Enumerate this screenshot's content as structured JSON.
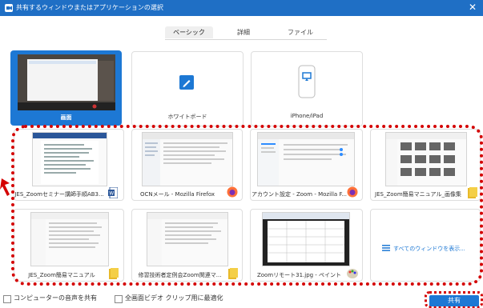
{
  "titlebar": {
    "title": "共有するウィンドウまたはアプリケーションの選択",
    "close_label": "✕"
  },
  "tabs": [
    {
      "label": "ベーシック",
      "active": true
    },
    {
      "label": "詳細",
      "active": false
    },
    {
      "label": "ファイル",
      "active": false
    }
  ],
  "top_tiles": {
    "screen": {
      "label": "画面"
    },
    "whiteboard": {
      "label": "ホワイトボード"
    },
    "iphone": {
      "label": "iPhone/iPad"
    }
  },
  "windows": [
    {
      "label": "JES_Zoomセミナー講師手順AB3...",
      "icon": "word-icon"
    },
    {
      "label": "OCNメール - Mozilla Firefox",
      "icon": "firefox-icon"
    },
    {
      "label": "アカウント設定 - Zoom - Mozilla F...",
      "icon": "firefox-icon"
    },
    {
      "label": "JES_Zoom簡易マニュアル_画像集",
      "icon": "folder-icon"
    },
    {
      "label": "JES_Zoom簡易マニュアル",
      "icon": "folder-icon"
    },
    {
      "label": "修習技術者定例会Zoom関連マ...",
      "icon": "folder-icon"
    },
    {
      "label": "Zoomリモート31.jpg - ペイント",
      "icon": "paint-icon"
    },
    {
      "label": "すべてのウィンドウを表示...",
      "icon": "windows-list-icon"
    }
  ],
  "bottom": {
    "share_audio_label": "コンピューターの音声を共有",
    "optimize_video_label": "全画面ビデオ クリップ用に最適化",
    "share_button_label": "共有"
  },
  "colors": {
    "accent": "#1d78d4",
    "titlebar": "#1f6fc5",
    "highlight_dots": "#d40000"
  }
}
